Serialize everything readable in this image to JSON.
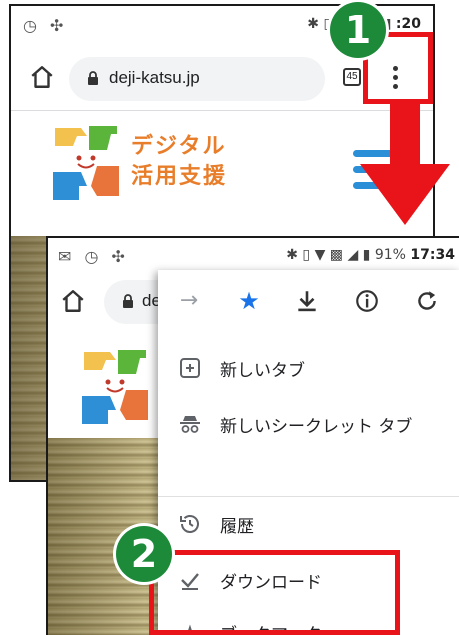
{
  "back_screen": {
    "status_bar": {
      "time": ":20"
    },
    "address_bar": {
      "url": "deji-katsu.jp",
      "tab_count": "45"
    },
    "site": {
      "brand_line1": "デジタル",
      "brand_line2": "活用支援"
    }
  },
  "front_screen": {
    "status_bar": {
      "battery": "91%",
      "time": "17:34"
    },
    "address_bar": {
      "url": "de"
    },
    "menu": {
      "items": [
        {
          "label": "新しいタブ",
          "icon": "plus-box-icon"
        },
        {
          "label": "新しいシークレット タブ",
          "icon": "incognito-icon"
        },
        {
          "label": "履歴",
          "icon": "history-icon"
        },
        {
          "label": "ダウンロード",
          "icon": "check-download-icon"
        },
        {
          "label": "ブックマーク",
          "icon": "star-icon"
        }
      ]
    }
  },
  "annotations": {
    "step1": "1",
    "step2": "2",
    "highlight_color": "#e8141a",
    "badge_color": "#1d8a3a"
  }
}
